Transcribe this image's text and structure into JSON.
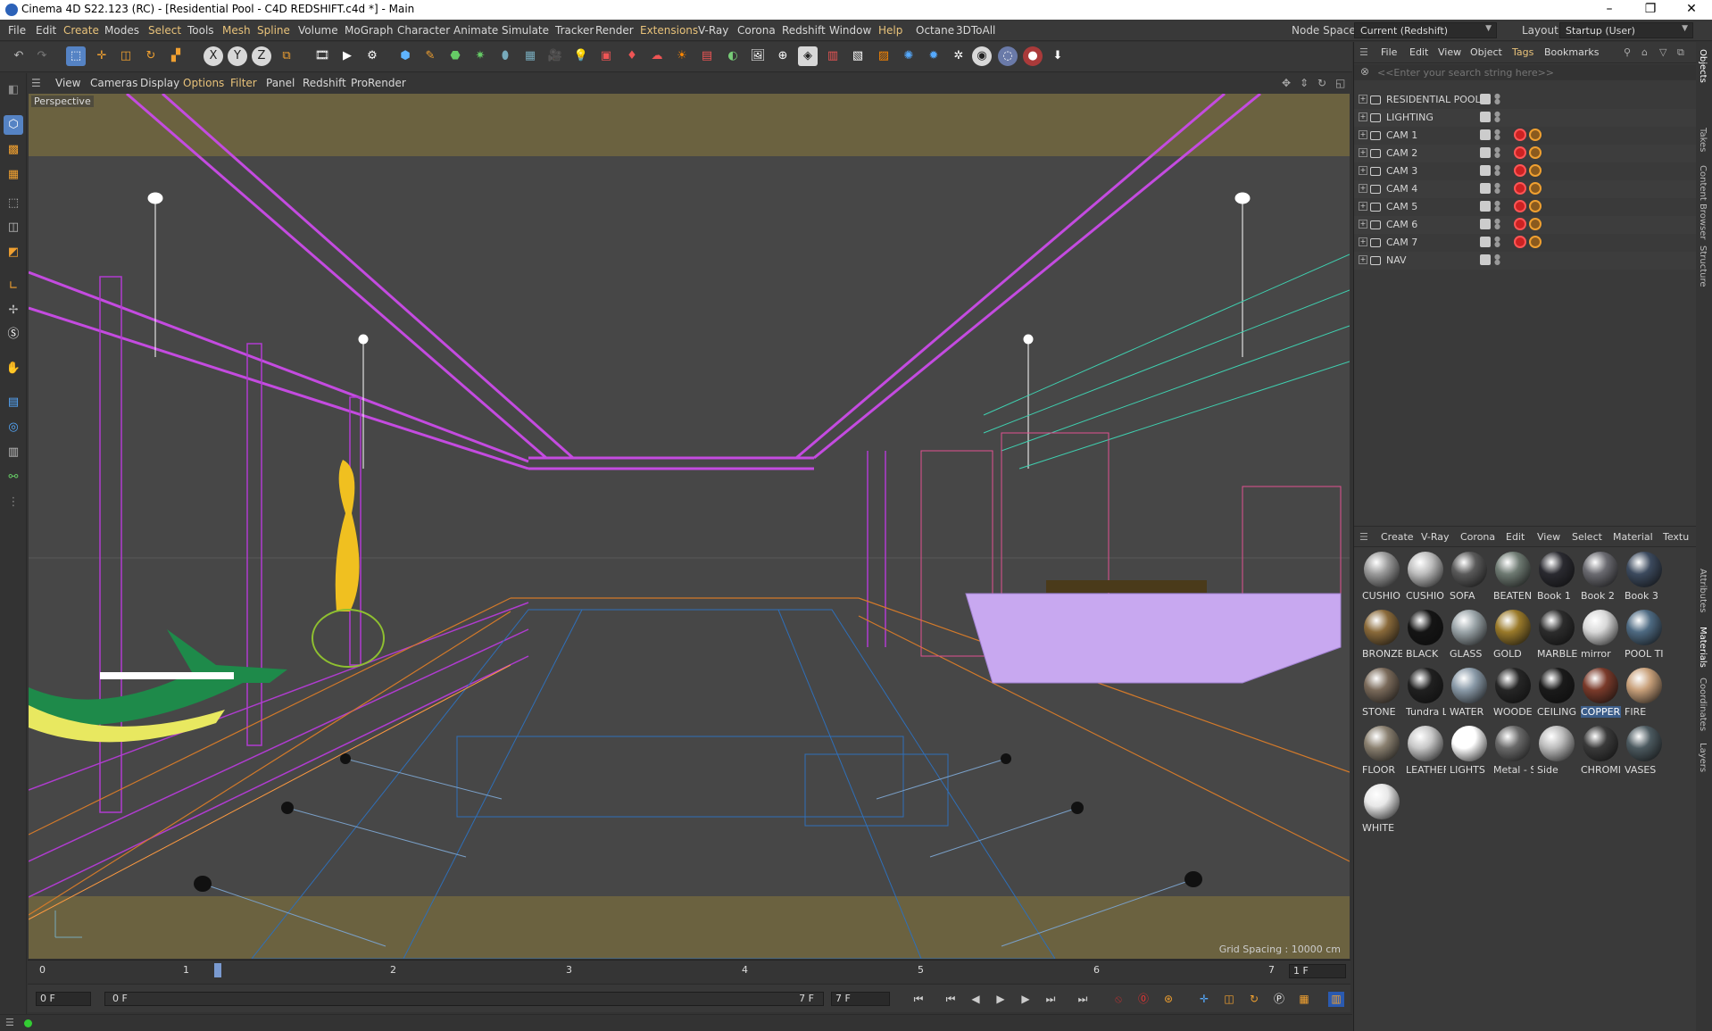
{
  "window": {
    "title": "Cinema 4D S22.123 (RC) - [Residential Pool - C4D REDSHIFT.c4d *] - Main",
    "controls": [
      "–",
      "❐",
      "✕"
    ]
  },
  "menubar": {
    "items": [
      "File",
      "Edit",
      "Create",
      "Modes",
      "Select",
      "Tools",
      "Mesh",
      "Spline",
      "Volume",
      "MoGraph",
      "Character",
      "Animate",
      "Simulate",
      "Tracker",
      "Render",
      "Extensions",
      "V-Ray",
      "Corona",
      "Redshift",
      "Window",
      "Help",
      "Octane",
      "3DToAll"
    ],
    "node_space_label": "Node Space:",
    "node_space_value": "Current (Redshift)",
    "layout_label": "Layout:",
    "layout_value": "Startup (User)"
  },
  "viewport_menu": {
    "items": [
      "View",
      "Cameras",
      "Display",
      "Options",
      "Filter",
      "Panel",
      "Redshift",
      "ProRender"
    ]
  },
  "viewport": {
    "label": "Perspective",
    "grid_spacing": "Grid Spacing : 10000 cm"
  },
  "timeline": {
    "ticks": [
      "0",
      "1",
      "2",
      "3",
      "4",
      "5",
      "6",
      "7"
    ],
    "end_field": "1 F"
  },
  "playback": {
    "current_frame": "0 F",
    "range_start": "0 F",
    "range_end": "7 F",
    "max_frame": "7 F"
  },
  "object_manager": {
    "menu": [
      "File",
      "Edit",
      "View",
      "Object",
      "Tags",
      "Bookmarks"
    ],
    "search_placeholder": "<<Enter your search string here>>",
    "objects": [
      {
        "name": "RESIDENTIAL POOL",
        "type": "layer",
        "tags": false
      },
      {
        "name": "LIGHTING",
        "type": "layer",
        "tags": false
      },
      {
        "name": "CAM 1",
        "type": "camera",
        "tags": true
      },
      {
        "name": "CAM 2",
        "type": "camera",
        "tags": true
      },
      {
        "name": "CAM 3",
        "type": "camera",
        "tags": true
      },
      {
        "name": "CAM 4",
        "type": "camera",
        "tags": true
      },
      {
        "name": "CAM 5",
        "type": "camera",
        "tags": true
      },
      {
        "name": "CAM 6",
        "type": "camera",
        "tags": true
      },
      {
        "name": "CAM 7",
        "type": "camera",
        "tags": true
      },
      {
        "name": "NAV",
        "type": "camera",
        "tags": false
      }
    ]
  },
  "material_manager": {
    "menu": [
      "Create",
      "V-Ray",
      "Corona",
      "Edit",
      "View",
      "Select",
      "Material",
      "Textu"
    ],
    "materials": [
      {
        "name": "CUSHIO",
        "color": "#9a9a9a"
      },
      {
        "name": "CUSHIO",
        "color": "#bdbdbd"
      },
      {
        "name": "SOFA",
        "color": "#5a5a5a"
      },
      {
        "name": "BEATEN",
        "color": "#6e7a72"
      },
      {
        "name": "Book 1",
        "color": "#2a2a30"
      },
      {
        "name": "Book 2",
        "color": "#6a6a70"
      },
      {
        "name": "Book 3",
        "color": "#3c4a5e"
      },
      {
        "name": "BRONZE",
        "color": "#8a6a3a"
      },
      {
        "name": "BLACK",
        "color": "#151515"
      },
      {
        "name": "GLASS",
        "color": "#9aa4a8"
      },
      {
        "name": "GOLD",
        "color": "#9a7a2a"
      },
      {
        "name": "MARBLE",
        "color": "#2c2c2c"
      },
      {
        "name": "mirror",
        "color": "#d8d8d8"
      },
      {
        "name": "POOL TI",
        "color": "#4e6a82"
      },
      {
        "name": "STONE",
        "color": "#7a6a5a"
      },
      {
        "name": "Tundra L",
        "color": "#202020"
      },
      {
        "name": "WATER",
        "color": "#8a9aa8"
      },
      {
        "name": "WOODE",
        "color": "#262626"
      },
      {
        "name": "CEILING",
        "color": "#1a1a1a"
      },
      {
        "name": "COPPER",
        "color": "#7a3a2a"
      },
      {
        "name": "FIRE",
        "color": "#c8a07a"
      },
      {
        "name": "FLOOR",
        "color": "#8a8070"
      },
      {
        "name": "LEATHEF",
        "color": "#c8c8c8"
      },
      {
        "name": "LIGHTS",
        "color": "#ffffff"
      },
      {
        "name": "Metal - S",
        "color": "#6a6a6a"
      },
      {
        "name": "Side",
        "color": "#bcbcbc"
      },
      {
        "name": "CHROMI",
        "color": "#3a3a3a"
      },
      {
        "name": "VASES",
        "color": "#4c5a60"
      },
      {
        "name": "WHITE",
        "color": "#e8e8e8"
      }
    ],
    "selected": "COPPER"
  },
  "side_tabs": [
    "Objects",
    "Takes",
    "Content Browser",
    "Structure",
    "Attributes",
    "Materials",
    "Coordinates",
    "Layers"
  ]
}
